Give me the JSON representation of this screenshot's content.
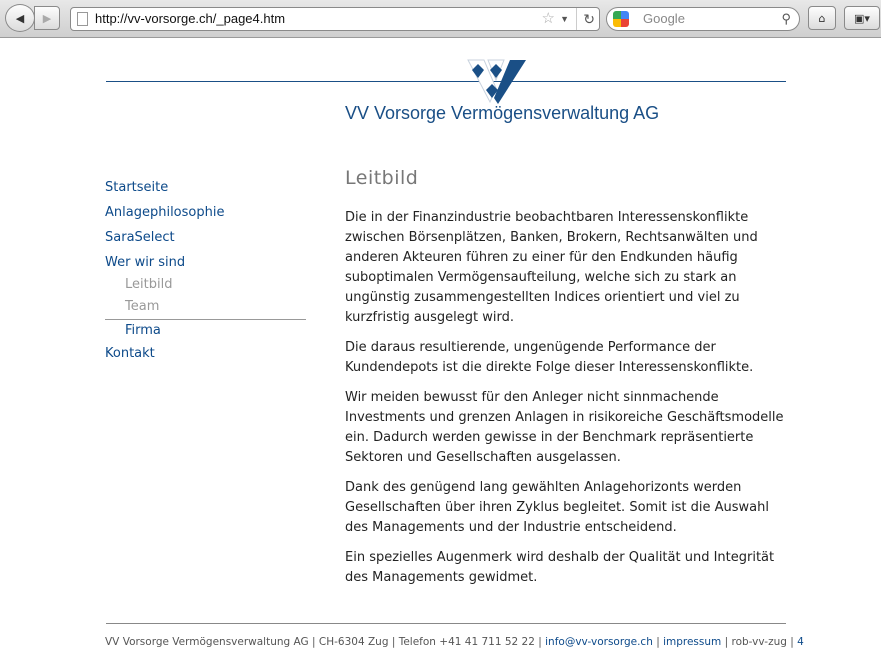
{
  "browser": {
    "url": "http://vv-vorsorge.ch/_page4.htm",
    "search_placeholder": "Google"
  },
  "brand": {
    "name": "VV Vorsorge Vermögensverwaltung AG"
  },
  "nav": {
    "items": [
      "Startseite",
      "Anlagephilosophie",
      "SaraSelect",
      "Wer wir sind"
    ],
    "sub": [
      "Leitbild",
      "Team",
      "Firma"
    ],
    "last": "Kontakt"
  },
  "page": {
    "title": "Leitbild",
    "paragraphs": [
      "Die in der Finanzindustrie beobachtbaren Interessenskonflikte zwischen Börsenplätzen, Banken, Brokern, Rechtsanwälten und anderen Akteuren führen zu einer für den Endkunden häufig suboptimalen Vermögensaufteilung, welche sich zu stark an ungünstig zusammengestellten Indices orientiert und viel zu kurzfristig ausgelegt wird.",
      "Die daraus resultierende, ungenügende Performance der Kundendepots ist die direkte Folge dieser Interessenskonflikte.",
      "Wir meiden bewusst für den Anleger nicht sinnmachende Investments und grenzen Anlagen in risikoreiche Geschäftsmodelle ein. Dadurch werden gewisse in der Benchmark repräsentierte Sektoren und Gesellschaften ausgelassen.",
      "Dank des genügend lang gewählten Anlagehorizonts werden Gesellschaften über ihren Zyklus begleitet. Somit ist die Auswahl des Managements und der Industrie entscheidend.",
      "Ein spezielles Augenmerk wird deshalb der Qualität und Integrität des Managements gewidmet."
    ]
  },
  "footer": {
    "company": "VV Vorsorge Vermögensverwaltung AG",
    "address": "CH-6304 Zug",
    "phone": "Telefon +41 41 711 52 22",
    "email": "info@vv-vorsorge.ch",
    "impressum": "impressum",
    "credit": "rob-vv-zug",
    "page": "4",
    "sep": " | "
  },
  "colors": {
    "brand": "#1a4f86",
    "link": "#0d4a8a"
  }
}
